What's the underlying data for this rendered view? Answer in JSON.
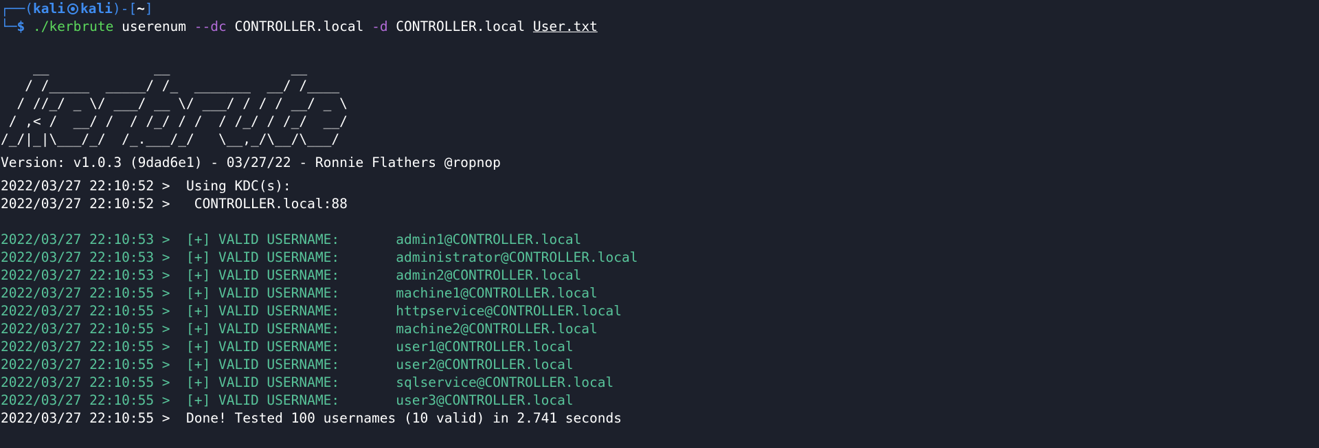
{
  "prompt": {
    "box_open": "┌──(",
    "user": "kali",
    "host": "kali",
    "close_bracket": ")-[",
    "cwd": "~",
    "end_bracket": "]",
    "line2_prefix": "└─",
    "dollar": "$ ",
    "icon": "kali-skull-icon"
  },
  "command": {
    "binary": "./kerbrute",
    "sub": " userenum ",
    "opt_dc": "--dc",
    "dc_value": " CONTROLLER.local ",
    "opt_d": "-d",
    "d_value": " CONTROLLER.local ",
    "userfile": "User.txt"
  },
  "banner": "    __             __               __     \n   / /_____  _____/ /_  _______  __/ /____ \n  / //_/ _ \\/ ___/ __ \\/ ___/ / / / __/ _ \\\n / ,< /  __/ /  / /_/ / /  / /_/ / /_/  __/\n/_/|_|\\___/_/  /_.___/_/   \\__,_/\\__/\\___/ ",
  "version": "Version: v1.0.3 (9dad6e1) - 03/27/22 - Ronnie Flathers @ropnop",
  "kdc": {
    "line1_time": "2022/03/27 22:10:52 >  ",
    "line1_text": "Using KDC(s):",
    "line2_time": "2022/03/27 22:10:52 >   ",
    "line2_text": "CONTROLLER.local:88"
  },
  "valid_prefix": "[+] VALID USERNAME:",
  "results": [
    {
      "time": "2022/03/27 22:10:53",
      "user": "admin1@CONTROLLER.local"
    },
    {
      "time": "2022/03/27 22:10:53",
      "user": "administrator@CONTROLLER.local"
    },
    {
      "time": "2022/03/27 22:10:53",
      "user": "admin2@CONTROLLER.local"
    },
    {
      "time": "2022/03/27 22:10:55",
      "user": "machine1@CONTROLLER.local"
    },
    {
      "time": "2022/03/27 22:10:55",
      "user": "httpservice@CONTROLLER.local"
    },
    {
      "time": "2022/03/27 22:10:55",
      "user": "machine2@CONTROLLER.local"
    },
    {
      "time": "2022/03/27 22:10:55",
      "user": "user1@CONTROLLER.local"
    },
    {
      "time": "2022/03/27 22:10:55",
      "user": "user2@CONTROLLER.local"
    },
    {
      "time": "2022/03/27 22:10:55",
      "user": "sqlservice@CONTROLLER.local"
    },
    {
      "time": "2022/03/27 22:10:55",
      "user": "user3@CONTROLLER.local"
    }
  ],
  "done": {
    "time": "2022/03/27 22:10:55 >  ",
    "text": "Done! Tested 100 usernames (10 valid) in 2.741 seconds"
  },
  "colors": {
    "background": "#1c202b",
    "prompt_blue": "#3f8cf0",
    "command_green": "#5cd85c",
    "option_purple": "#b26bd8",
    "valid_green": "#58c49a"
  }
}
